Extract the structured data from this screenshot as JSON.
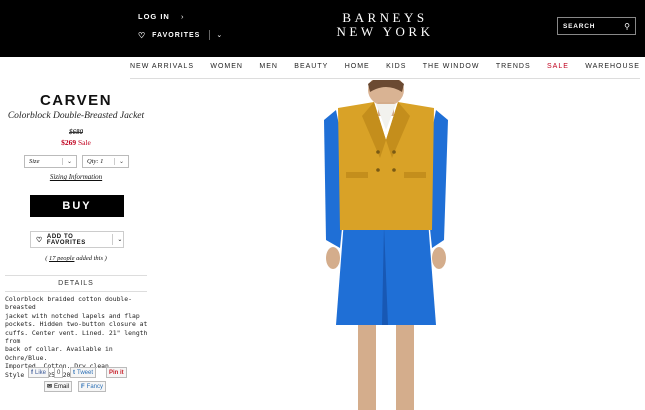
{
  "header": {
    "login_label": "LOG IN",
    "login_chevron": "›",
    "favorites_label": "FAVORITES",
    "favorites_dropdown": "⌄",
    "logo_line1": "BARNEYS",
    "logo_line2": "NEW YORK",
    "search_placeholder": "SEARCH",
    "icons": [
      "heart-icon",
      "search-icon",
      "chevron-right-icon",
      "chevron-down-icon"
    ]
  },
  "nav": {
    "items": [
      "NEW ARRIVALS",
      "WOMEN",
      "MEN",
      "BEAUTY",
      "HOME",
      "KIDS",
      "THE WINDOW",
      "TRENDS",
      "SALE",
      "WAREHOUSE"
    ],
    "sale_color": "#c0001e"
  },
  "product": {
    "brand": "CARVEN",
    "name": "Colorblock Double-Breasted Jacket",
    "original_price": "$680",
    "sale_price_amount": "$269",
    "sale_price_label": "Sale",
    "size_select": "Size",
    "qty_select": "Qty: 1",
    "sizing_link": "Sizing Information",
    "buy_label": "BUY",
    "add_favorites_label": "ADD TO FAVORITES",
    "added_prefix": "( ",
    "added_count": "17 people",
    "added_suffix": " added this )",
    "details_heading": "DETAILS",
    "description": [
      "Colorblock braided cotton double-breasted",
      "jacket with notched lapels and flap",
      "pockets. Hidden two-button closure at",
      "cuffs. Center vent. Lined. 21\" length from",
      "back of collar. Available in Ochre/Blue.",
      "Imported. Cotton. Dry clean.",
      "Style # 502256920"
    ],
    "jacket_color": "#d9a227",
    "dress_color": "#1f6fd6"
  },
  "social": {
    "like_label": "Like",
    "like_count": "0",
    "tweet_label": "Tweet",
    "pin_label": "Pin it",
    "email_label": "Email",
    "fancy_label": "Fancy"
  }
}
